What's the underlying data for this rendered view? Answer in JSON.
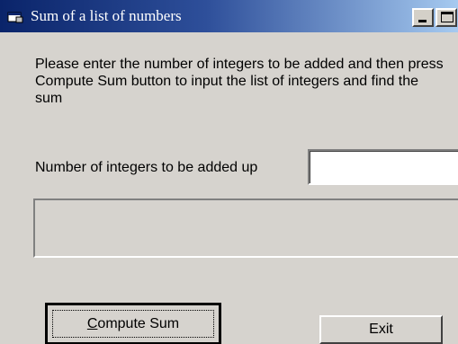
{
  "window": {
    "title": "Sum of a list of numbers",
    "icon": "app-window-icon"
  },
  "title_buttons": {
    "minimize_icon": "minimize-icon",
    "maximize_icon": "maximize-icon"
  },
  "form": {
    "instructions": "Please enter the number of integers to  be added and then press Compute Sum button to input the list of integers and find the sum",
    "count_label": "Number of integers to be added up",
    "count_value": "",
    "result_text": ""
  },
  "buttons": {
    "compute_accel": "C",
    "compute_rest": "ompute Sum",
    "exit_label": "Exit"
  },
  "colors": {
    "titlebar_start": "#0a246a",
    "titlebar_end": "#a6caf0",
    "face": "#d6d3ce"
  }
}
